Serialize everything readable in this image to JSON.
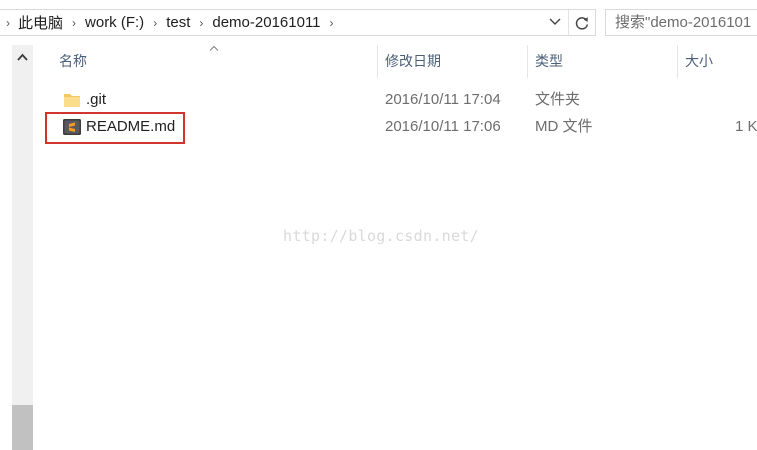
{
  "address_bar": {
    "breadcrumbs": [
      "此电脑",
      "work (F:)",
      "test",
      "demo-20161011"
    ]
  },
  "search": {
    "placeholder": "搜索\"demo-2016101"
  },
  "columns": {
    "name": "名称",
    "date": "修改日期",
    "type": "类型",
    "size": "大小"
  },
  "files": [
    {
      "name": ".git",
      "date": "2016/10/11 17:04",
      "type": "文件夹",
      "size": "",
      "icon": "folder-icon"
    },
    {
      "name": "README.md",
      "date": "2016/10/11 17:06",
      "type": "MD 文件",
      "size": "1 K",
      "icon": "sublime-text-file-icon"
    }
  ],
  "watermark": "http://blog.csdn.net/",
  "colors": {
    "header_text": "#4c607a",
    "highlight_border": "#d0342c",
    "folder": "#f4c862"
  }
}
